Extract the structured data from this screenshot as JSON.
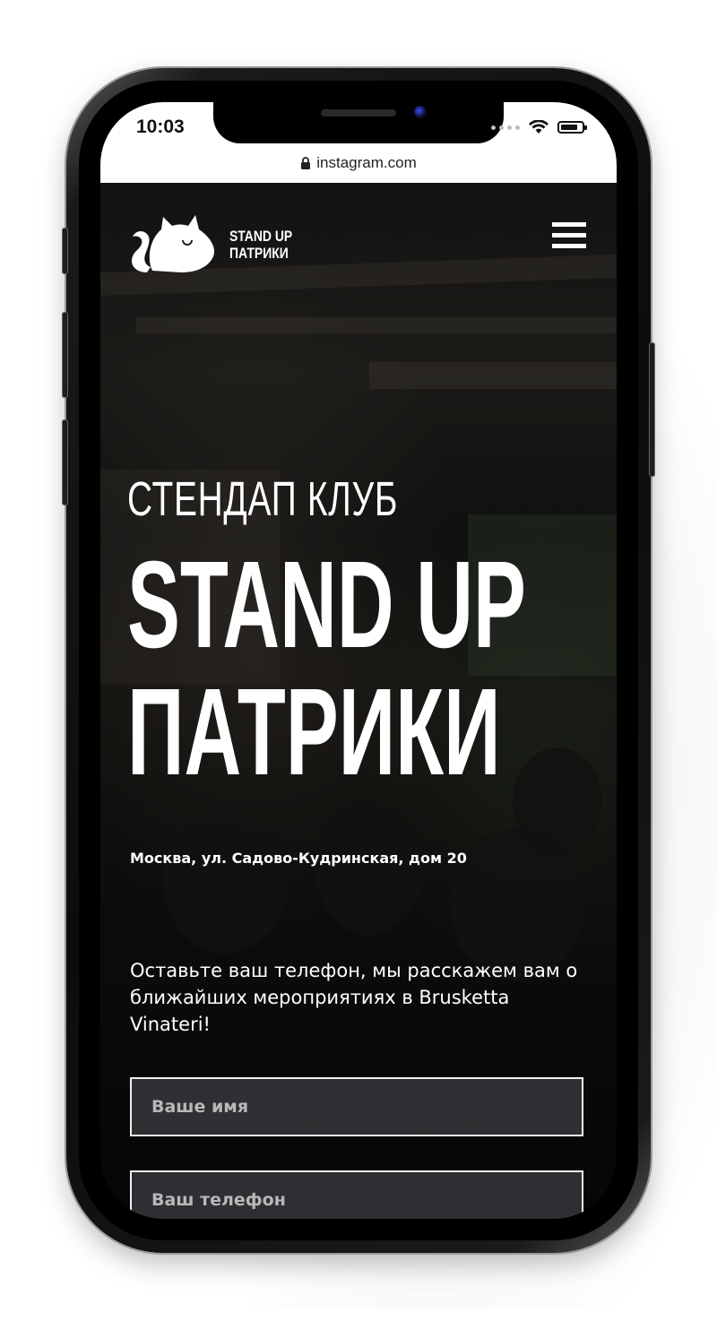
{
  "status_bar": {
    "time": "10:03",
    "icons": [
      "signal-dots-icon",
      "wifi-icon",
      "battery-icon"
    ]
  },
  "browser": {
    "url": "instagram.com",
    "lock_icon": "lock-icon"
  },
  "header": {
    "logo_line1": "STAND UP",
    "logo_line2": "ПАТРИКИ",
    "menu_icon": "hamburger-menu-icon"
  },
  "hero": {
    "subtitle": "СТЕНДАП КЛУБ",
    "title_line1": "STAND UP",
    "title_line2": "ПАТРИКИ",
    "address": "Москва, ул. Садово-Кудринская, дом 20",
    "cta": "Оставьте ваш телефон, мы расскажем вам о ближайших мероприятиях в Brusketta Vinateri!"
  },
  "form": {
    "name_placeholder": "Ваше имя",
    "phone_placeholder": "Ваш телефон"
  },
  "colors": {
    "text": "#ffffff",
    "field_border": "#f2f2f2",
    "placeholder": "#b8b8b8"
  }
}
